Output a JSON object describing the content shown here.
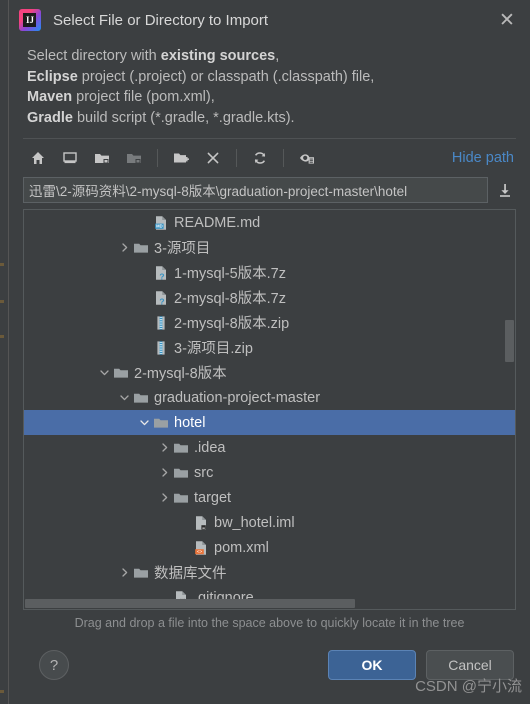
{
  "window": {
    "title": "Select File or Directory to Import",
    "app_icon": "intellij-idea-logo",
    "close_label": "✕"
  },
  "description": {
    "line1_prefix": "Select directory with ",
    "line1_bold": "existing sources",
    "line1_suffix": ",",
    "line2_bold": "Eclipse",
    "line2_rest": " project (.project) or classpath (.classpath) file,",
    "line3_bold": "Maven",
    "line3_rest": " project file (pom.xml),",
    "line4_bold": "Gradle",
    "line4_rest": " build script (*.gradle, *.gradle.kts)."
  },
  "toolbar": {
    "buttons": [
      {
        "name": "home-icon",
        "tooltip": "Home"
      },
      {
        "name": "desktop-icon",
        "tooltip": "Desktop"
      },
      {
        "name": "expand-folder-icon",
        "tooltip": "Expand"
      },
      {
        "name": "collapse-folder-icon",
        "tooltip": "Collapse",
        "disabled": true
      },
      {
        "name": "new-folder-icon",
        "tooltip": "New Folder"
      },
      {
        "name": "delete-icon",
        "tooltip": "Delete"
      },
      {
        "name": "refresh-icon",
        "tooltip": "Refresh"
      },
      {
        "name": "show-hidden-files-icon",
        "tooltip": "Show Hidden Files"
      }
    ],
    "hide_path_label": "Hide path"
  },
  "path": {
    "value": "迅雷\\2-源码资料\\2-mysql-8版本\\graduation-project-master\\hotel",
    "drop_icon": "download-arrow-icon"
  },
  "tree": {
    "rows": [
      {
        "label": "README.md",
        "indent": 5,
        "arrow": "none",
        "icon": "markdown-file-icon"
      },
      {
        "label": "3-源项目",
        "indent": 4,
        "arrow": "collapsed",
        "icon": "folder-icon"
      },
      {
        "label": "1-mysql-5版本.7z",
        "indent": 5,
        "arrow": "none",
        "icon": "unknown-file-icon"
      },
      {
        "label": "2-mysql-8版本.7z",
        "indent": 5,
        "arrow": "none",
        "icon": "unknown-file-icon"
      },
      {
        "label": "2-mysql-8版本.zip",
        "indent": 5,
        "arrow": "none",
        "icon": "archive-file-icon"
      },
      {
        "label": "3-源项目.zip",
        "indent": 5,
        "arrow": "none",
        "icon": "archive-file-icon"
      },
      {
        "label": "2-mysql-8版本",
        "indent": 3,
        "arrow": "expanded",
        "icon": "folder-icon"
      },
      {
        "label": "graduation-project-master",
        "indent": 4,
        "arrow": "expanded",
        "icon": "folder-icon"
      },
      {
        "label": "hotel",
        "indent": 5,
        "arrow": "expanded",
        "icon": "folder-icon",
        "selected": true
      },
      {
        "label": ".idea",
        "indent": 6,
        "arrow": "collapsed",
        "icon": "folder-icon"
      },
      {
        "label": "src",
        "indent": 6,
        "arrow": "collapsed",
        "icon": "folder-icon"
      },
      {
        "label": "target",
        "indent": 6,
        "arrow": "collapsed",
        "icon": "folder-icon"
      },
      {
        "label": "bw_hotel.iml",
        "indent": 7,
        "arrow": "none",
        "icon": "iml-file-icon"
      },
      {
        "label": "pom.xml",
        "indent": 7,
        "arrow": "none",
        "icon": "xml-file-icon"
      },
      {
        "label": "数据库文件",
        "indent": 4,
        "arrow": "collapsed",
        "icon": "folder-icon"
      },
      {
        "label": ".gitignore",
        "indent": 6,
        "arrow": "none",
        "icon": "gitignore-file-icon"
      }
    ]
  },
  "hint": "Drag and drop a file into the space above to quickly locate it in the tree",
  "footer": {
    "help_label": "?",
    "ok_label": "OK",
    "cancel_label": "Cancel"
  },
  "watermark": "CSDN @宁小流",
  "colors": {
    "dialog_bg": "#3c3f41",
    "selection_blue": "#4a6da7",
    "link_blue": "#4a88c7",
    "ok_button_blue": "#3c6395",
    "text_primary": "#bfbfbf"
  }
}
